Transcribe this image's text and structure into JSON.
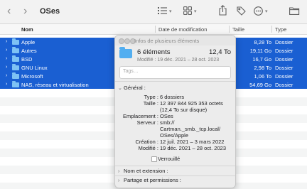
{
  "toolbar": {
    "back_glyph": "‹",
    "forward_glyph": "›",
    "title": "OSes",
    "icons": [
      "list-view-icon",
      "grid-view-icon",
      "share-icon",
      "tag-icon",
      "more-icon",
      "new-folder-icon"
    ]
  },
  "columns": {
    "name": "Nom",
    "modified": "Date de modification",
    "size": "Taille",
    "kind": "Type"
  },
  "rows": [
    {
      "name": "Apple",
      "size": "8,28 To",
      "kind": "Dossier"
    },
    {
      "name": "Autres",
      "size": "19,11 Go",
      "kind": "Dossier"
    },
    {
      "name": "BSD",
      "size": "16,7 Go",
      "kind": "Dossier"
    },
    {
      "name": "GNU Linux",
      "size": "2,98 To",
      "kind": "Dossier"
    },
    {
      "name": "Microsoft",
      "size": "1,06 To",
      "kind": "Dossier"
    },
    {
      "name": "NAS, réseau et virtualisation",
      "size": "54,69 Go",
      "kind": "Dossier"
    }
  ],
  "inspector": {
    "title": "Infos de plusieurs éléments",
    "count": "6 éléments",
    "total_size": "12,4 To",
    "modified_line": "Modifié : 19 déc. 2021 – 28 oct. 2023",
    "tags_placeholder": "Tags…",
    "general_header": "Général :",
    "labels": {
      "type": "Type :",
      "size": "Taille :",
      "location": "Emplacement :",
      "server": "Serveur :",
      "created": "Création :",
      "modified": "Modifié :"
    },
    "values": {
      "type": "6 dossiers",
      "size_line1": "12 397 844 925 353 octets",
      "size_line2": "(12,4 To sur disque)",
      "location": "OSes",
      "server_line1": "smb://",
      "server_line2": "Cartman._smb._tcp.local/",
      "server_line3": "OSes/Apple",
      "created": "12 juil. 2021 – 3 mars 2022",
      "modified": "19 déc. 2021 – 28 oct. 2023"
    },
    "locked_label": "Verrouillé",
    "name_ext_header": "Nom et extension :",
    "sharing_header": "Partage et permissions :"
  },
  "colors": {
    "selection": "#1a5fd2",
    "folder": "#7ec2f4",
    "stripe": "#f4f5f5"
  }
}
